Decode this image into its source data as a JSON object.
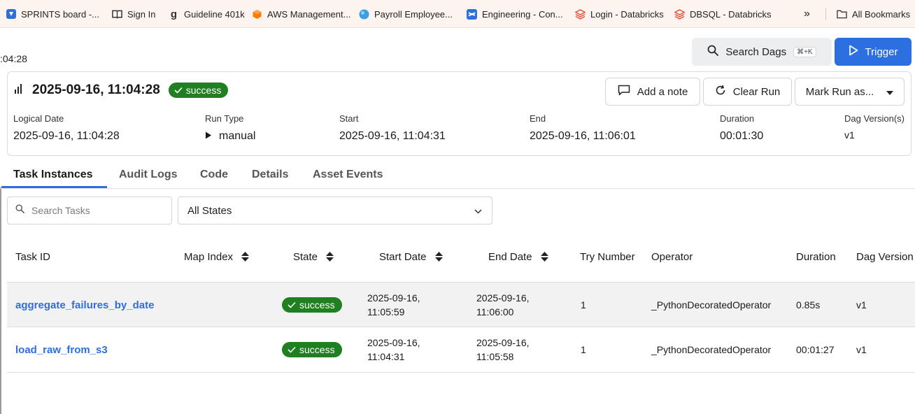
{
  "bookmarks": [
    {
      "label": "SPRINTS board -...",
      "icon": "jira-icon",
      "color": "#2f6fdc"
    },
    {
      "label": "Sign In",
      "icon": "book-icon",
      "color": "#333333"
    },
    {
      "label": "Guideline 401k",
      "icon": "g-letter-icon",
      "color": "#333333"
    },
    {
      "label": "AWS Management...",
      "icon": "aws-cube-icon",
      "color": "#ff7a00"
    },
    {
      "label": "Payroll Employee...",
      "icon": "globe-icon",
      "color": "#3b9fe0"
    },
    {
      "label": "Engineering - Con...",
      "icon": "confluence-icon",
      "color": "#2f6fdc"
    },
    {
      "label": "Login - Databricks",
      "icon": "databricks-icon",
      "color": "#e8533f"
    },
    {
      "label": "DBSQL - Databricks",
      "icon": "databricks-icon",
      "color": "#e8533f"
    }
  ],
  "bookmarks_overflow": "»",
  "all_bookmarks_label": "All Bookmarks",
  "header": {
    "time_fragment": ":04:28",
    "search_label": "Search Dags",
    "search_shortcut": "⌘+K",
    "trigger_label": "Trigger"
  },
  "run": {
    "title": "2025-09-16, 11:04:28",
    "status": "success",
    "add_note_label": "Add a note",
    "clear_run_label": "Clear Run",
    "mark_run_label": "Mark Run as...",
    "fields": {
      "logical_date": {
        "label": "Logical Date",
        "value": "2025-09-16, 11:04:28"
      },
      "run_type": {
        "label": "Run Type",
        "value": "manual"
      },
      "start": {
        "label": "Start",
        "value": "2025-09-16, 11:04:31"
      },
      "end": {
        "label": "End",
        "value": "2025-09-16, 11:06:01"
      },
      "duration": {
        "label": "Duration",
        "value": "00:01:30"
      },
      "dag_version": {
        "label": "Dag Version(s)",
        "value": "v1"
      }
    }
  },
  "tabs": [
    {
      "label": "Task Instances",
      "active": true
    },
    {
      "label": "Audit Logs",
      "active": false
    },
    {
      "label": "Code",
      "active": false
    },
    {
      "label": "Details",
      "active": false
    },
    {
      "label": "Asset Events",
      "active": false
    }
  ],
  "filters": {
    "search_placeholder": "Search Tasks",
    "state_selected": "All States"
  },
  "table": {
    "columns": {
      "task_id": "Task ID",
      "map_index": "Map Index",
      "state": "State",
      "start_date": "Start Date",
      "end_date": "End Date",
      "try_number": "Try Number",
      "operator": "Operator",
      "duration": "Duration",
      "dag_version": "Dag Version"
    },
    "rows": [
      {
        "task_id": "aggregate_failures_by_date",
        "map_index": "",
        "state": "success",
        "start_date_1": "2025-09-16,",
        "start_date_2": "11:05:59",
        "end_date_1": "2025-09-16,",
        "end_date_2": "11:06:00",
        "try_number": "1",
        "operator": "_PythonDecoratedOperator",
        "duration": "0.85s",
        "dag_version": "v1"
      },
      {
        "task_id": "load_raw_from_s3",
        "map_index": "",
        "state": "success",
        "start_date_1": "2025-09-16,",
        "start_date_2": "11:04:31",
        "end_date_1": "2025-09-16,",
        "end_date_2": "11:05:58",
        "try_number": "1",
        "operator": "_PythonDecoratedOperator",
        "duration": "00:01:27",
        "dag_version": "v1"
      }
    ]
  },
  "colors": {
    "accent": "#2c6fe0",
    "success": "#1f7f21",
    "bookmarks_bg": "#fdf4ef"
  }
}
